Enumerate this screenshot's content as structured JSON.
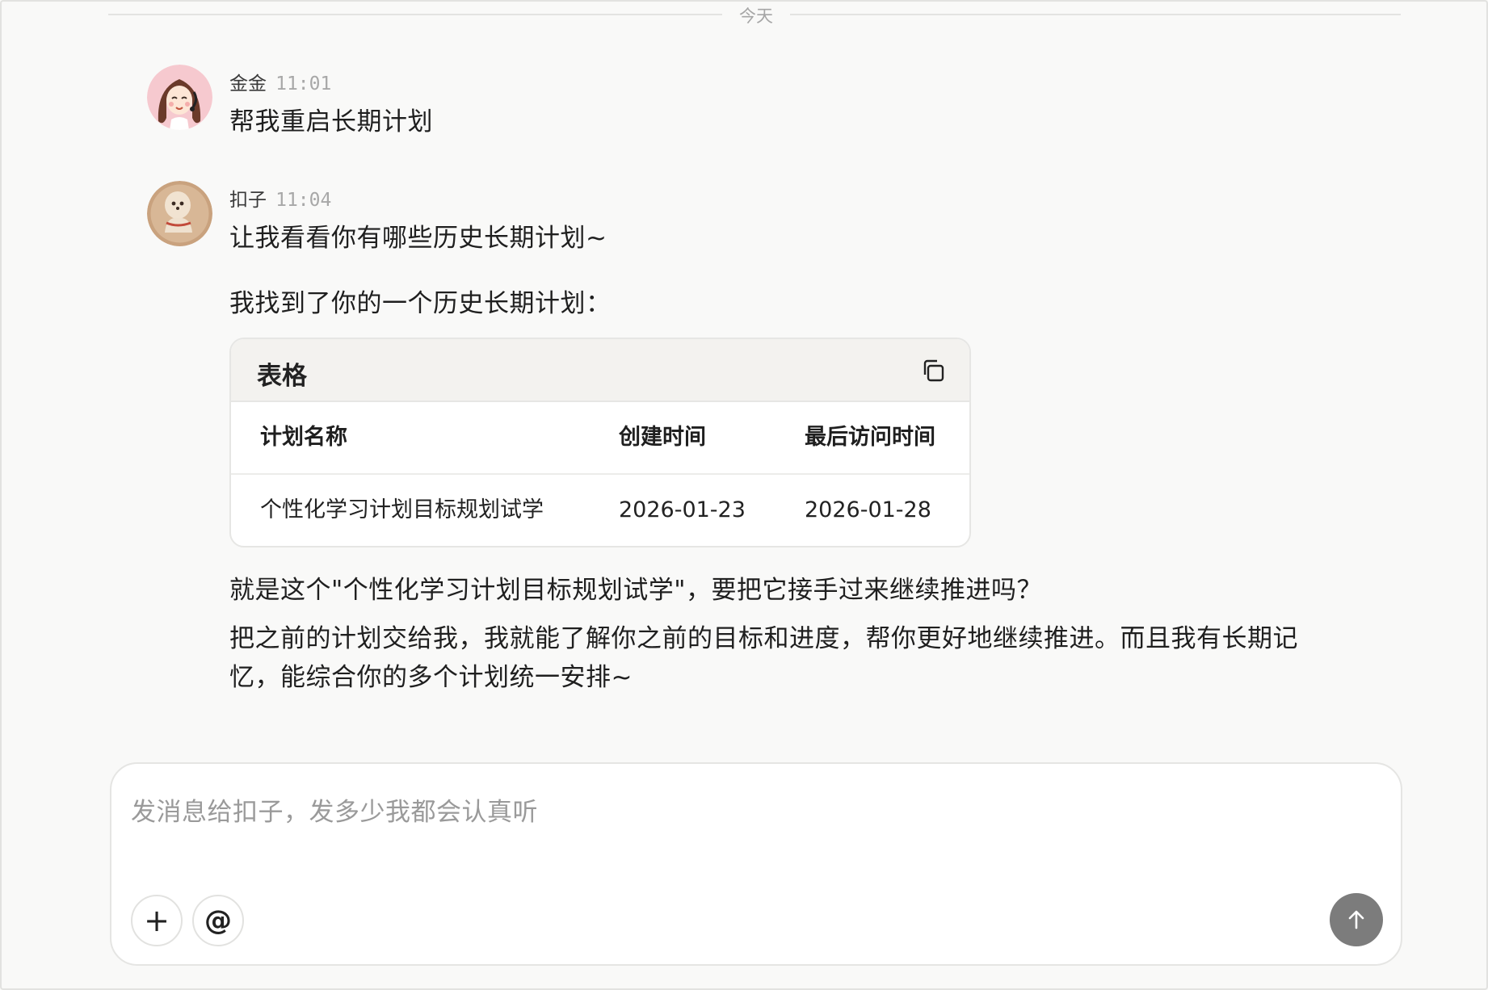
{
  "divider": {
    "label": "今天"
  },
  "messages": [
    {
      "sender": "金金",
      "time": "11:01",
      "avatar_icon": "user-avatar-icon",
      "lines": [
        "帮我重启长期计划"
      ]
    },
    {
      "sender": "扣子",
      "time": "11:04",
      "avatar_icon": "bot-avatar-icon",
      "lines": [
        "让我看看你有哪些历史长期计划~",
        "我找到了你的一个历史长期计划："
      ],
      "table": {
        "title": "表格",
        "copy_icon": "copy-icon",
        "columns": [
          "计划名称",
          "创建时间",
          "最后访问时间"
        ],
        "rows": [
          [
            "个性化学习计划目标规划试学",
            "2026-01-23",
            "2026-01-28"
          ]
        ]
      },
      "after_lines": [
        "就是这个\"个性化学习计划目标规划试学\"，要把它接手过来继续推进吗？",
        "把之前的计划交给我，我就能了解你之前的目标和进度，帮你更好地继续推进。而且我有长期记",
        "忆，能综合你的多个计划统一安排~"
      ]
    }
  ],
  "composer": {
    "placeholder": "发消息给扣子，发多少我都会认真听",
    "plus_label": "+",
    "at_label": "@",
    "send_icon": "arrow-up-icon"
  },
  "colors": {
    "background": "#f9f9f8",
    "send_button": "#7c7c7c",
    "table_header_bg": "#f3f2ef"
  }
}
